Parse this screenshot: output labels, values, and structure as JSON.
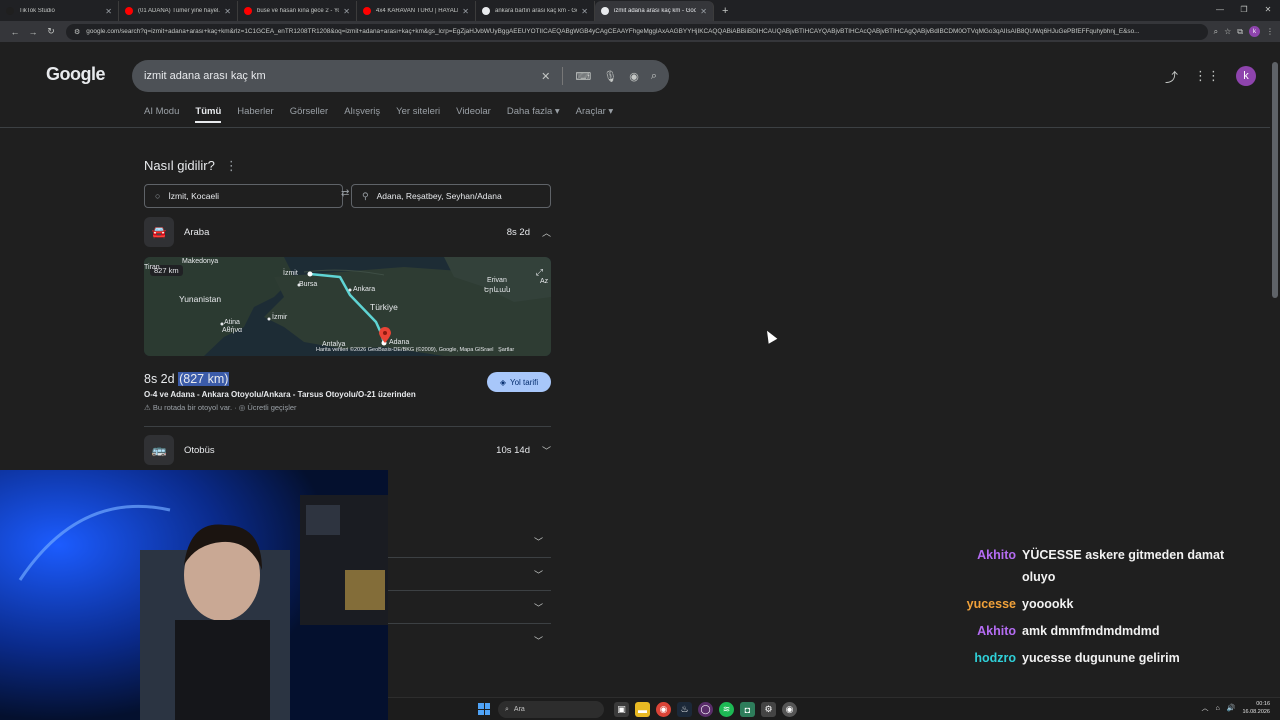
{
  "browser": {
    "tabs": [
      {
        "title": "TikTok Studio",
        "favicon_color": "#1f1f1f",
        "active": false
      },
      {
        "title": "(01 ADANA) Tümer yine hayel...",
        "favicon_color": "#ff0000",
        "active": false
      },
      {
        "title": "buse ve hasan kına gece 2 - Yo...",
        "favicon_color": "#ff0000",
        "active": false
      },
      {
        "title": "4x4 KARAVAN TURU | HAYALİM...",
        "favicon_color": "#ff0000",
        "active": false
      },
      {
        "title": "ankara bartın arası kaç km - Go...",
        "favicon_color": "#e8eaed",
        "active": false
      },
      {
        "title": "izmit adana arası kaç km - Goo...",
        "favicon_color": "#e8eaed",
        "active": true
      }
    ],
    "new_tab": "+",
    "url": "google.com/search?q=izmit+adana+arası+kaç+km&rlz=1C1GCEA_enTR1208TR1208&oq=izmit+adana+arası+kaç+km&gs_lcrp=EgZjaHJvbWUyBggAEEUYOTIICAEQABgWGB4yCAgCEAAYFhgeMggIAxAAGBYYHjIKCAQQABiABBiiBDIHCAUQABjvBTIHCAYQABjvBTIHCAcQABjvBTIHCAgQABjvBdIBCDM0OTVqMGo3qAIIsAIB8QUWq6HJuGePBfEFFquhybhnj_E&so...",
    "profile_letter": "k"
  },
  "google": {
    "logo": "Google",
    "query": "izmit adana arası kaç km",
    "avatar_letter": "k",
    "tabs": [
      "AI Modu",
      "Tümü",
      "Haberler",
      "Görseller",
      "Alışveriş",
      "Yer siteleri",
      "Videolar",
      "Daha fazla ▾",
      "Araçlar ▾"
    ],
    "active_tab": "Tümü"
  },
  "directions": {
    "title": "Nasıl gidilir?",
    "origin": "İzmit, Kocaeli",
    "destination": "Adana, Reşatbey, Seyhan/Adana",
    "car": {
      "label": "Araba",
      "duration": "8s 2d"
    },
    "map": {
      "badge": "827 km",
      "labels": {
        "izmit": "İzmit",
        "bursa": "Bursa",
        "ankara": "Ankara",
        "turkiye": "Türkiye",
        "izmir": "İzmir",
        "yunanistan": "Yunanistan",
        "makedonya": "Makedonya",
        "tirana": "Tiran",
        "atina": "Atina",
        "atina_gr": "Αθήνα",
        "antalya": "Antalya",
        "adana": "Adana",
        "erivan": "Erivan",
        "erivan_hy": "Երևան",
        "az": "Az"
      },
      "credit": "Harita verileri ©2026 GeoBasis-DE/BKG (©2009), Google, Mapa GISrael",
      "terms": "Şartlar"
    },
    "summary_time": "8s 2d",
    "summary_distance": "(827 km)",
    "via": "O-4 ve Adana - Ankara Otoyolu/Ankara - Tarsus Otoyolu/O-21 üzerinden",
    "note_highway": "Bu rotada bir otoyol var.",
    "note_toll": "Ücretli geçişler",
    "route_button": "Yol tarifi",
    "bus": {
      "label": "Otobüs",
      "duration": "10s 14d"
    }
  },
  "chat": [
    {
      "user": "Akhito",
      "color": "#b46cf2",
      "text": "YÜCESSE askere gitmeden damat oluyo"
    },
    {
      "user": "yucesse",
      "color": "#f0a13a",
      "text": "yooookk"
    },
    {
      "user": "Akhito",
      "color": "#b46cf2",
      "text": "amk dmmfmdmdmdmd"
    },
    {
      "user": "hodzro",
      "color": "#2fd0d8",
      "text": "yucesse dugunune gelirim"
    }
  ],
  "taskbar": {
    "search_placeholder": "Ara",
    "time": "00:16",
    "date": "16.08.2026"
  }
}
